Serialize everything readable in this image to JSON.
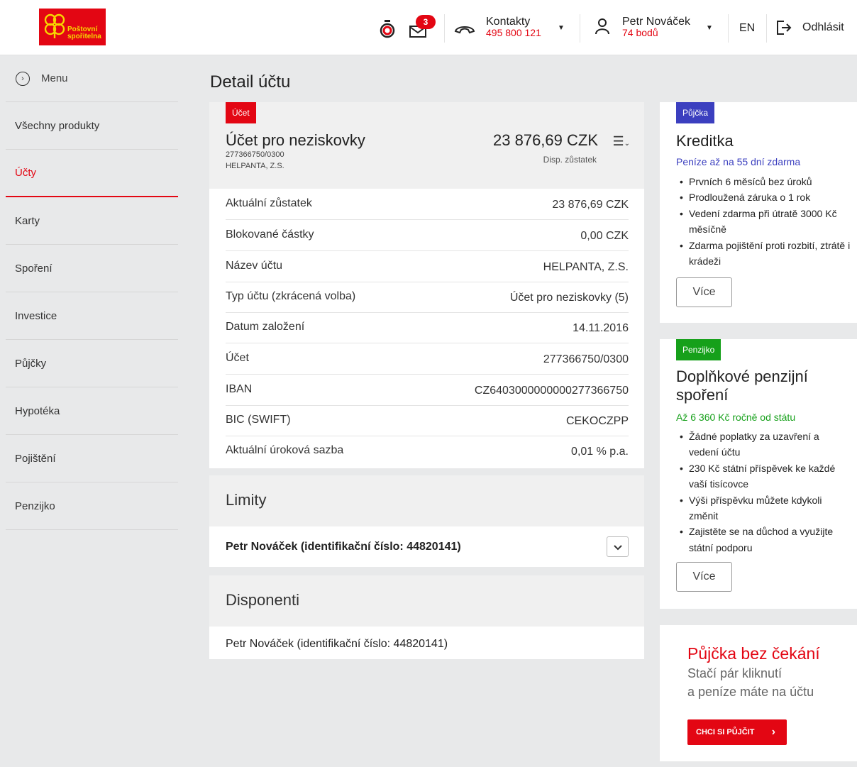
{
  "header": {
    "logo_text_1": "Poštovní",
    "logo_text_2": "spořitelna",
    "mail_badge": "3",
    "contacts_label": "Kontakty",
    "contacts_phone": "495 800 121",
    "user_name": "Petr Nováček",
    "user_points": "74 bodů",
    "lang": "EN",
    "logout": "Odhlásit"
  },
  "sidebar": {
    "menu_label": "Menu",
    "items": [
      {
        "label": "Všechny produkty"
      },
      {
        "label": "Účty"
      },
      {
        "label": "Karty"
      },
      {
        "label": "Spoření"
      },
      {
        "label": "Investice"
      },
      {
        "label": "Půjčky"
      },
      {
        "label": "Hypotéka"
      },
      {
        "label": "Pojištění"
      },
      {
        "label": "Penzijko"
      }
    ]
  },
  "page_title": "Detail účtu",
  "account": {
    "tag": "Účet",
    "name": "Účet pro neziskovky",
    "number": "277366750/0300",
    "owner": "HELPANTA, Z.S.",
    "balance": "23 876,69 CZK",
    "balance_label": "Disp. zůstatek",
    "details": [
      {
        "key": "Aktuální zůstatek",
        "value": "23 876,69 CZK"
      },
      {
        "key": "Blokované částky",
        "value": "0,00 CZK"
      },
      {
        "key": "Název účtu",
        "value": "HELPANTA, Z.S."
      },
      {
        "key": "Typ účtu (zkrácená volba)",
        "value": "Účet pro neziskovky (5)"
      },
      {
        "key": "Datum založení",
        "value": "14.11.2016"
      },
      {
        "key": "Účet",
        "value": "277366750/0300"
      },
      {
        "key": "IBAN",
        "value": "CZ6403000000000277366750"
      },
      {
        "key": "BIC (SWIFT)",
        "value": "CEKOCZPP"
      },
      {
        "key": "Aktuální úroková sazba",
        "value": "0,01 % p.a."
      }
    ]
  },
  "limits": {
    "title": "Limity",
    "person": "Petr Nováček (identifikační číslo: 44820141)"
  },
  "disponents": {
    "title": "Disponenti",
    "person": "Petr Nováček (identifikační číslo: 44820141)"
  },
  "cards": {
    "loan_tag": "Půjčka",
    "loan_title": "Kreditka",
    "loan_sub": "Peníze až na 55 dní zdarma",
    "loan_bullets": [
      "Prvních 6 měsíců bez úroků",
      "Prodloužená záruka o 1 rok",
      "Vedení zdarma při útratě 3000 Kč měsíčně",
      "Zdarma pojištění proti rozbití, ztrátě i krádeži"
    ],
    "more": "Více",
    "pension_tag": "Penzijko",
    "pension_title": "Doplňkové penzijní spoření",
    "pension_sub": "Až 6 360 Kč ročně od státu",
    "pension_bullets": [
      "Žádné poplatky za uzavření a vedení účtu",
      "230 Kč státní příspěvek ke každé vaší tisícovce",
      "Výši příspěvku můžete kdykoli změnit",
      "Zajistěte se na důchod a využijte státní podporu"
    ],
    "promo_title": "Půjčka bez čekání",
    "promo_line1": "Stačí pár kliknutí",
    "promo_line2": "a peníze máte na účtu",
    "promo_button": "CHCI SI PŮJČIT"
  },
  "colors": {
    "brand_red": "#e30613",
    "loan_blue": "#3b3fbf",
    "pension_green": "#16a01a"
  }
}
